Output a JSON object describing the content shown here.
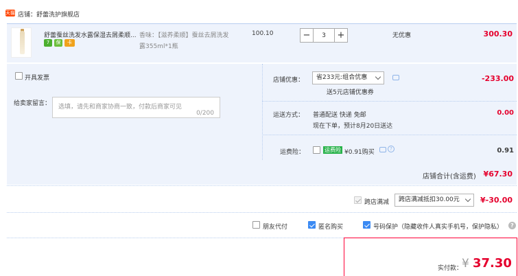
{
  "shop": {
    "label": "店铺：舒蕾洗护旗舰店",
    "icon_text": "天猫"
  },
  "item": {
    "title": "舒蕾蚕丝洗发水露保湿去屑柔顺...",
    "sku_line1": "香味：【滋养柔顺】蚕丝去屑洗发",
    "sku_line2": "露355ml*1瓶",
    "unit_price": "100.10",
    "quantity": "3",
    "discount": "无优惠",
    "subtotal": "300.30",
    "badges": [
      {
        "text": "7",
        "color": "#4caf2f"
      },
      {
        "text": "保",
        "color": "#6bbf3b"
      },
      {
        "text": "卡",
        "color": "#f0a21b"
      }
    ],
    "qty_minus": "−",
    "qty_plus": "+"
  },
  "invoice": {
    "label": "开具发票"
  },
  "message": {
    "label": "给卖家留言：",
    "placeholder": "选填，请先和商家协商一致，付款后商家可见",
    "counter": "0/200"
  },
  "shop_discount": {
    "label": "店铺优惠：",
    "selected": "省233元:组合优惠",
    "note": "送5元店铺优惠券",
    "amount": "-233.00"
  },
  "shipping": {
    "label": "运送方式：",
    "method": "普通配送 快递 免邮",
    "eta": "现在下单，预计8月20日送达",
    "amount": "0.00"
  },
  "insurance": {
    "label": "运费险：",
    "tag": "运费险",
    "text": "¥0.91购买",
    "amount": "0.91"
  },
  "shop_total": {
    "label": "店铺合计(含运费)",
    "amount": "¥67.30"
  },
  "cross_store": {
    "label": "跨店满减",
    "selected": "跨店满减抵扣30.00元",
    "amount": "¥-30.00"
  },
  "options": {
    "friend_pay": "朋友代付",
    "anonymous": "匿名购买",
    "number_protect": "号码保护（隐藏收件人真实手机号，保护隐私）"
  },
  "payment": {
    "label": "实付款：",
    "currency": "¥",
    "amount": "37.30"
  },
  "colors": {
    "accent_red": "#ff0036",
    "tint_blue": "#eef3fc",
    "check_blue": "#3b8af3"
  }
}
